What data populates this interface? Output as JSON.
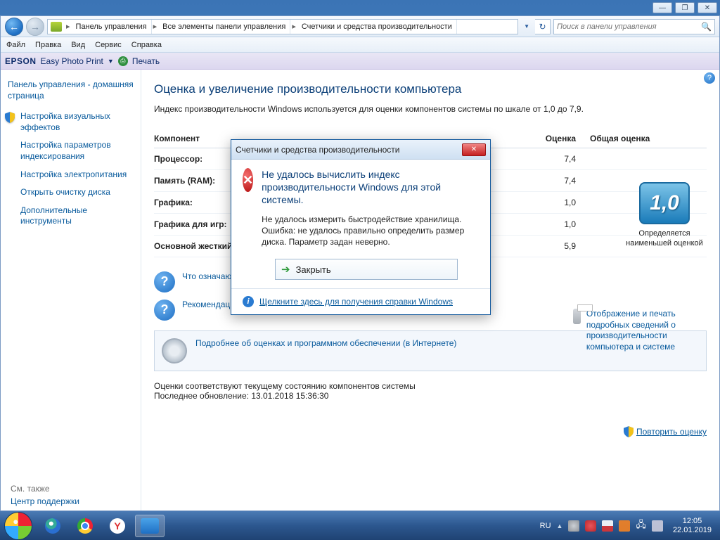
{
  "window_controls": {
    "minimize": "—",
    "maximize": "❐",
    "close": "✕"
  },
  "nav": {
    "breadcrumb": [
      "Панель управления",
      "Все элементы панели управления",
      "Счетчики и средства производительности"
    ],
    "search_placeholder": "Поиск в панели управления"
  },
  "menubar": [
    "Файл",
    "Правка",
    "Вид",
    "Сервис",
    "Справка"
  ],
  "toolbar": {
    "brand": "EPSON",
    "app": "Easy Photo Print",
    "print": "Печать"
  },
  "sidebar": {
    "home": "Панель управления - домашняя страница",
    "links": [
      "Настройка визуальных эффектов",
      "Настройка параметров индексирования",
      "Настройка электропитания",
      "Открыть очистку диска",
      "Дополнительные инструменты"
    ],
    "see_also_label": "См. также",
    "see_also_link": "Центр поддержки"
  },
  "main": {
    "title": "Оценка и увеличение производительности компьютера",
    "desc": "Индекс производительности Windows используется для оценки компонентов системы по шкале от 1,0 до 7,9.",
    "col_component": "Компонент",
    "col_score": "Оценка",
    "col_base": "Общая оценка",
    "rows": [
      {
        "name": "Процессор:",
        "score": "7,4"
      },
      {
        "name": "Память (RAM):",
        "score": "7,4"
      },
      {
        "name": "Графика:",
        "score": "1,0"
      },
      {
        "name": "Графика для игр:",
        "score": "1,0"
      },
      {
        "name": "Основной жесткий диск:",
        "score": "5,9"
      }
    ],
    "bigscore_value": "1,0",
    "bigscore_caption": "Определяется наименьшей оценкой",
    "links": {
      "what": "Что означают эти цифры?",
      "tips": "Рекомендации по повышению производительности компьютера.",
      "print": "Отображение и печать подробных сведений о производительности компьютера и системе",
      "more": "Подробнее об оценках и программном обеспечении (в Интернете)"
    },
    "footer_line1": "Оценки соответствуют текущему состоянию компонентов системы",
    "footer_line2": "Последнее обновление: 13.01.2018 15:36:30",
    "repeat_link": "Повторить оценку"
  },
  "modal": {
    "title": "Счетчики и средства производительности",
    "heading": "Не удалось вычислить индекс производительности Windows для этой системы.",
    "body": "Не удалось измерить быстродействие хранилища. Ошибка: не удалось правильно определить размер диска. Параметр задан неверно.",
    "close_btn": "Закрыть",
    "help_link": "Щелкните здесь для получения справки Windows"
  },
  "taskbar": {
    "lang": "RU",
    "time": "12:05",
    "date": "22.01.2019"
  }
}
